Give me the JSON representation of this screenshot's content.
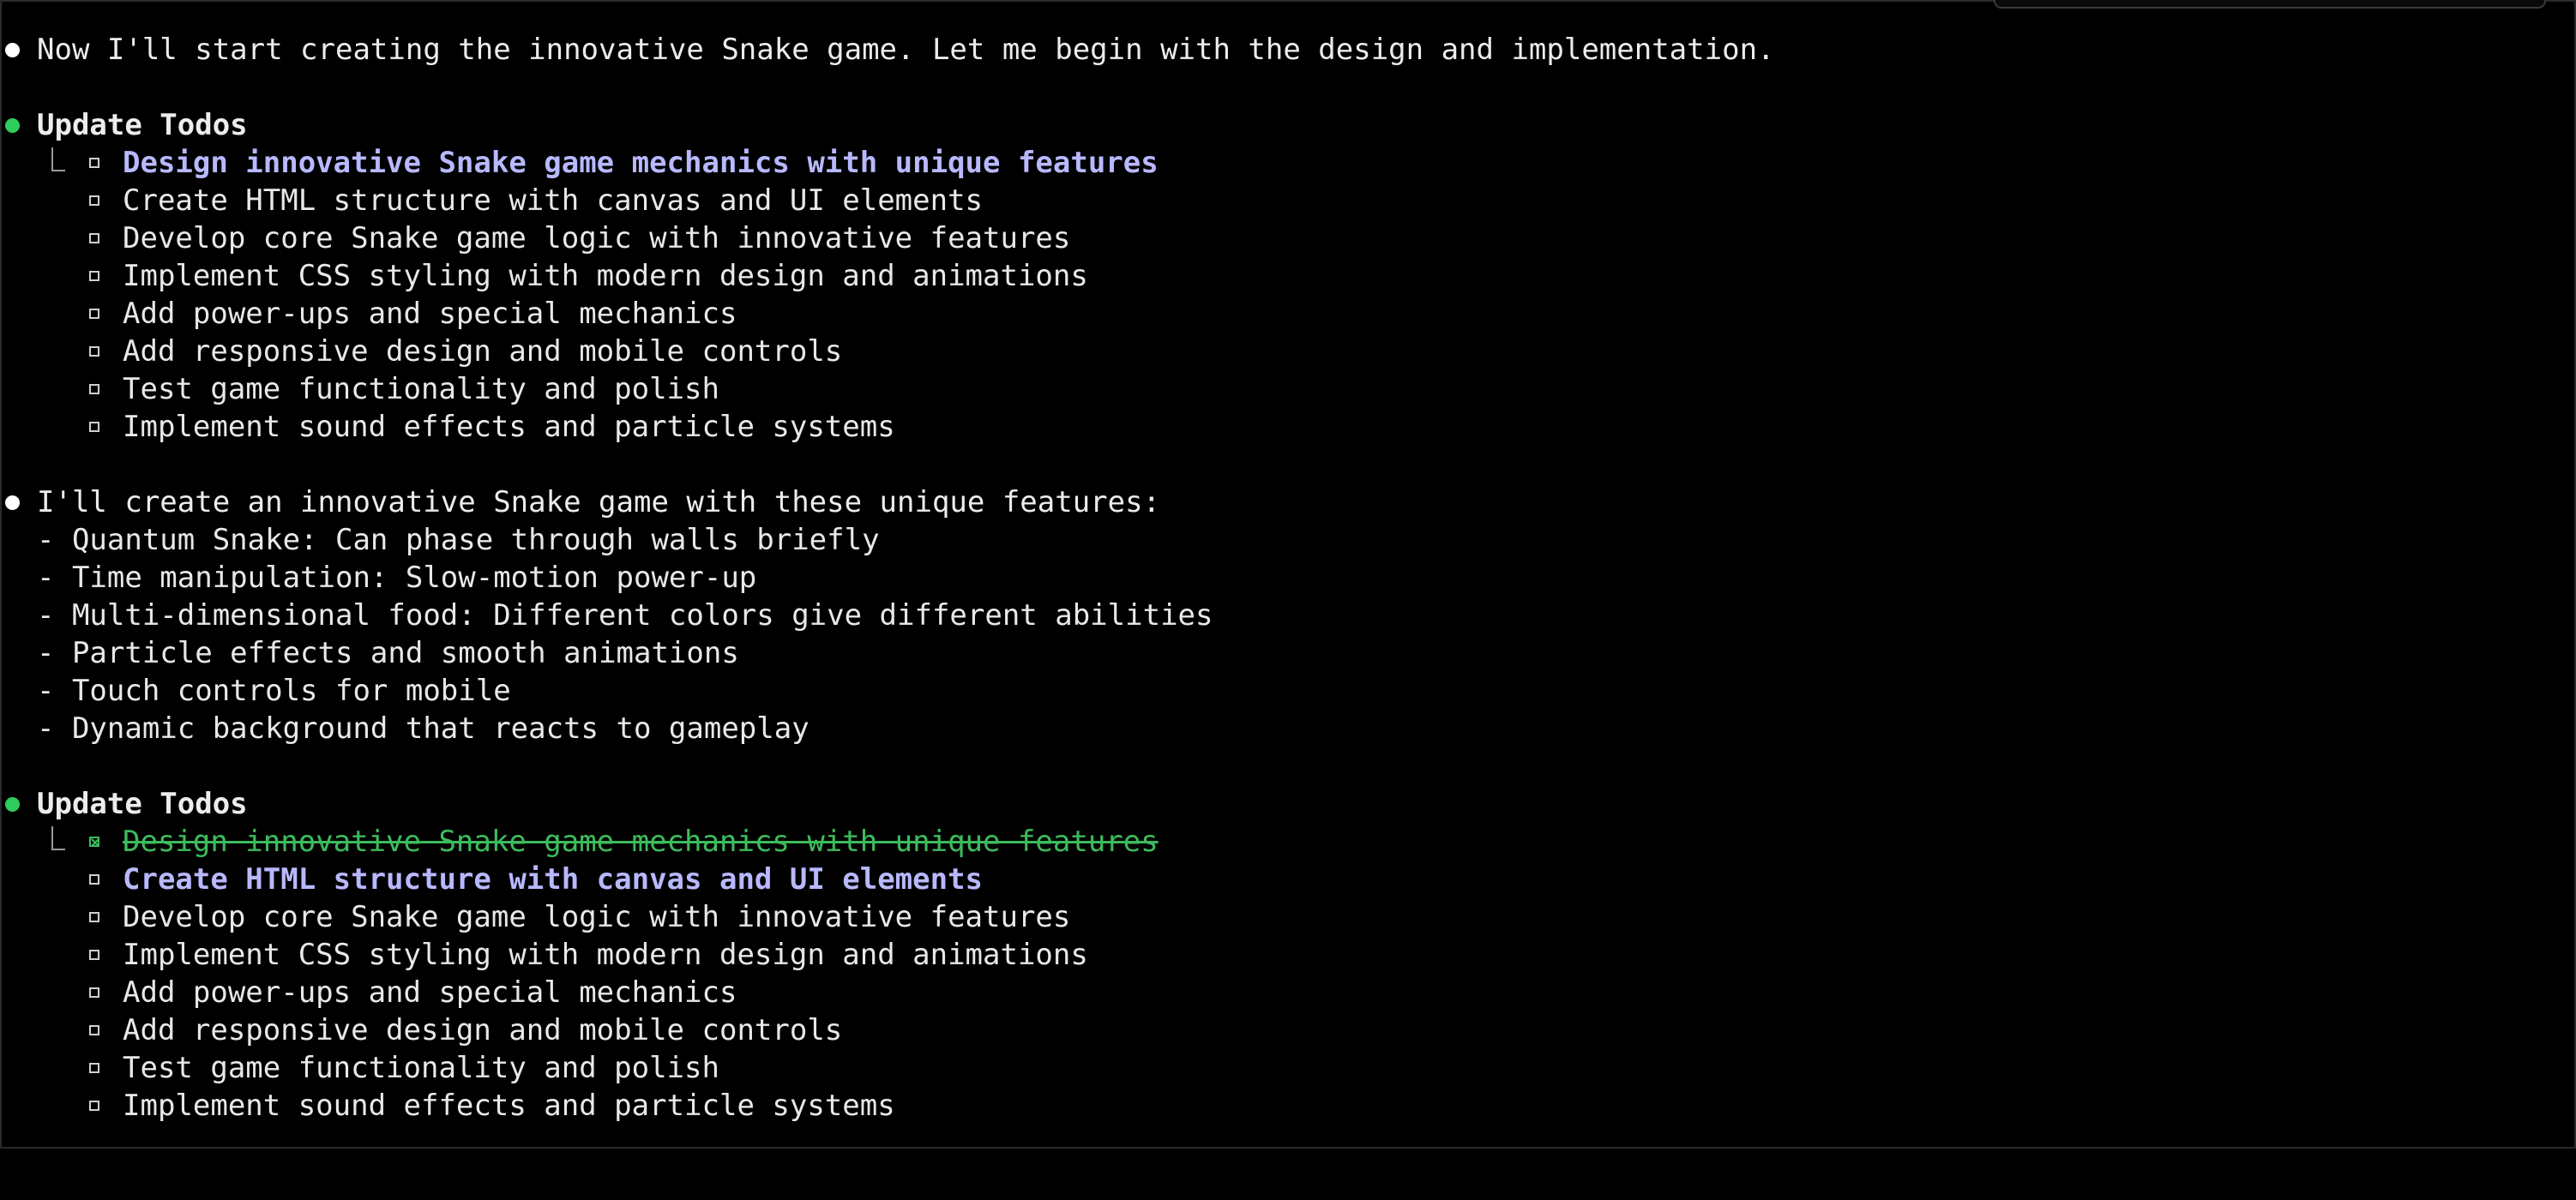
{
  "colors": {
    "background": "#000000",
    "text": "#e8e8e8",
    "bullet_message": "#ffffff",
    "bullet_tool": "#2ecc5a",
    "active_todo": "#b8b8ff",
    "completed_todo": "#3dbb5c"
  },
  "messages": {
    "intro": "Now I'll start creating the innovative Snake game. Let me begin with the design and implementation.",
    "features_intro": "I'll create an innovative Snake game with these unique features:",
    "features": [
      "- Quantum Snake: Can phase through walls briefly",
      "- Time manipulation: Slow-motion power-up",
      "- Multi-dimensional food: Different colors give different abilities",
      "- Particle effects and smooth animations",
      "- Touch controls for mobile",
      "- Dynamic background that reacts to gameplay"
    ]
  },
  "todos1": {
    "title": "Update Todos",
    "items": [
      {
        "label": "Design innovative Snake game mechanics with unique features",
        "state": "active"
      },
      {
        "label": "Create HTML structure with canvas and UI elements",
        "state": "pending"
      },
      {
        "label": "Develop core Snake game logic with innovative features",
        "state": "pending"
      },
      {
        "label": "Implement CSS styling with modern design and animations",
        "state": "pending"
      },
      {
        "label": "Add power-ups and special mechanics",
        "state": "pending"
      },
      {
        "label": "Add responsive design and mobile controls",
        "state": "pending"
      },
      {
        "label": "Test game functionality and polish",
        "state": "pending"
      },
      {
        "label": "Implement sound effects and particle systems",
        "state": "pending"
      }
    ]
  },
  "todos2": {
    "title": "Update Todos",
    "items": [
      {
        "label": "Design innovative Snake game mechanics with unique features",
        "state": "completed"
      },
      {
        "label": "Create HTML structure with canvas and UI elements",
        "state": "active"
      },
      {
        "label": "Develop core Snake game logic with innovative features",
        "state": "pending"
      },
      {
        "label": "Implement CSS styling with modern design and animations",
        "state": "pending"
      },
      {
        "label": "Add power-ups and special mechanics",
        "state": "pending"
      },
      {
        "label": "Add responsive design and mobile controls",
        "state": "pending"
      },
      {
        "label": "Test game functionality and polish",
        "state": "pending"
      },
      {
        "label": "Implement sound effects and particle systems",
        "state": "pending"
      }
    ]
  }
}
